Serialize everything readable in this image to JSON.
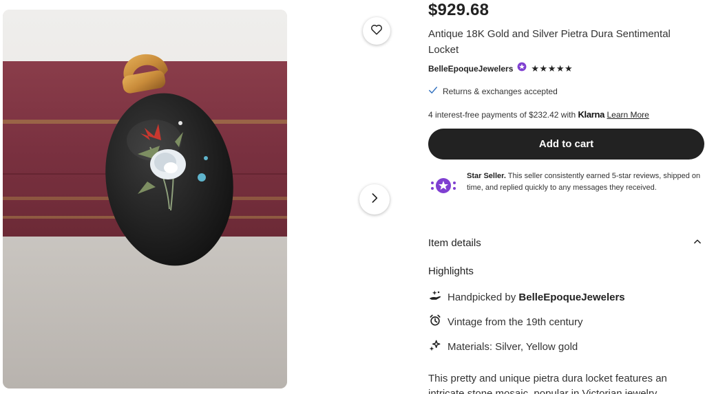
{
  "listing": {
    "price": "$929.68",
    "title": "Antique 18K Gold and Silver Pietra Dura Sentimental Locket",
    "shop_name": "BelleEpoqueJewelers",
    "rating_stars": "★★★★★",
    "returns_text": "Returns & exchanges accepted",
    "klarna": {
      "prefix": "4 interest-free payments of $232.42 with ",
      "brand": "Klarna",
      "learn_more": "Learn More"
    },
    "add_to_cart": "Add to cart"
  },
  "star_seller": {
    "title": "Star Seller.",
    "text": " This seller consistently earned 5-star reviews, shipped on time, and replied quickly to any messages they received."
  },
  "item_details": {
    "label": "Item details",
    "highlights_label": "Highlights",
    "highlights": [
      {
        "prefix": "Handpicked by ",
        "bold": "BelleEpoqueJewelers",
        "icon": "hand-sparkle-icon"
      },
      {
        "text": "Vintage from the 19th century",
        "icon": "alarm-clock-icon"
      },
      {
        "text": "Materials: Silver, Yellow gold",
        "icon": "sparkles-icon"
      }
    ],
    "description": "This pretty and unique pietra dura locket features an intricate stone mosaic, popular in Victorian jewelry"
  },
  "colors": {
    "cart_button": "#222222",
    "star_seller_purple": "#7f3fd1",
    "check_blue": "#2f6fbf"
  }
}
